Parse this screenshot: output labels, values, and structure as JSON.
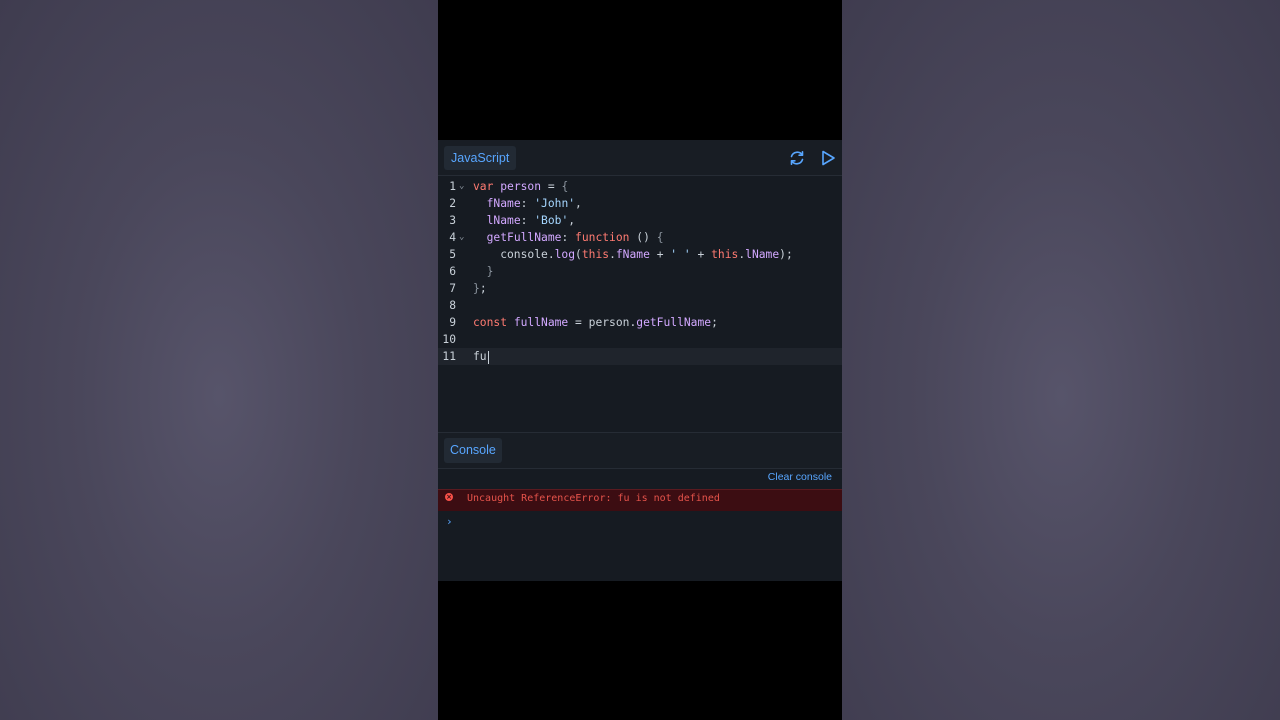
{
  "editor": {
    "language_tab": "JavaScript",
    "refresh_icon": "refresh-icon",
    "run_icon": "play-icon",
    "accent": "#58a6ff",
    "lines": [
      {
        "n": "1",
        "tokens": [
          [
            "kw",
            "var"
          ],
          [
            "",
            " "
          ],
          [
            "vr",
            "person"
          ],
          [
            "",
            " = "
          ],
          [
            "pn",
            "{"
          ]
        ],
        "fold": true
      },
      {
        "n": "2",
        "tokens": [
          [
            "",
            "  "
          ],
          [
            "pr",
            "fName"
          ],
          [
            "",
            ": "
          ],
          [
            "st",
            "'John'"
          ],
          [
            "",
            ","
          ]
        ]
      },
      {
        "n": "3",
        "tokens": [
          [
            "",
            "  "
          ],
          [
            "pr",
            "lName"
          ],
          [
            "",
            ": "
          ],
          [
            "st",
            "'Bob'"
          ],
          [
            "",
            ","
          ]
        ]
      },
      {
        "n": "4",
        "tokens": [
          [
            "",
            "  "
          ],
          [
            "pr",
            "getFullName"
          ],
          [
            "",
            ": "
          ],
          [
            "kw",
            "function"
          ],
          [
            "",
            " () "
          ],
          [
            "pn",
            "{"
          ]
        ],
        "fold": true
      },
      {
        "n": "5",
        "tokens": [
          [
            "",
            "    console."
          ],
          [
            "vr",
            "log"
          ],
          [
            "",
            "("
          ],
          [
            "kw",
            "this"
          ],
          [
            "",
            "."
          ],
          [
            "pr",
            "fName"
          ],
          [
            "",
            " + "
          ],
          [
            "st",
            "' '"
          ],
          [
            "",
            " + "
          ],
          [
            "kw",
            "this"
          ],
          [
            "",
            "."
          ],
          [
            "pr",
            "lName"
          ],
          [
            "",
            ");"
          ]
        ]
      },
      {
        "n": "6",
        "tokens": [
          [
            "",
            "  "
          ],
          [
            "pn",
            "}"
          ]
        ]
      },
      {
        "n": "7",
        "tokens": [
          [
            "pn",
            "}"
          ],
          [
            "",
            ";"
          ]
        ]
      },
      {
        "n": "8",
        "tokens": []
      },
      {
        "n": "9",
        "tokens": [
          [
            "kw",
            "const"
          ],
          [
            "",
            " "
          ],
          [
            "vr",
            "fullName"
          ],
          [
            "",
            " = person."
          ],
          [
            "pr",
            "getFullName"
          ],
          [
            "",
            ";"
          ]
        ]
      },
      {
        "n": "10",
        "tokens": []
      },
      {
        "n": "11",
        "tokens": [
          [
            "",
            "fu"
          ]
        ],
        "active": true,
        "cursor": true
      }
    ]
  },
  "console": {
    "tab": "Console",
    "clear_label": "Clear console",
    "error_icon": "error-icon",
    "error_text": "Uncaught ReferenceError: fu is not defined",
    "error_color": "#e5534b",
    "prompt": "›"
  }
}
